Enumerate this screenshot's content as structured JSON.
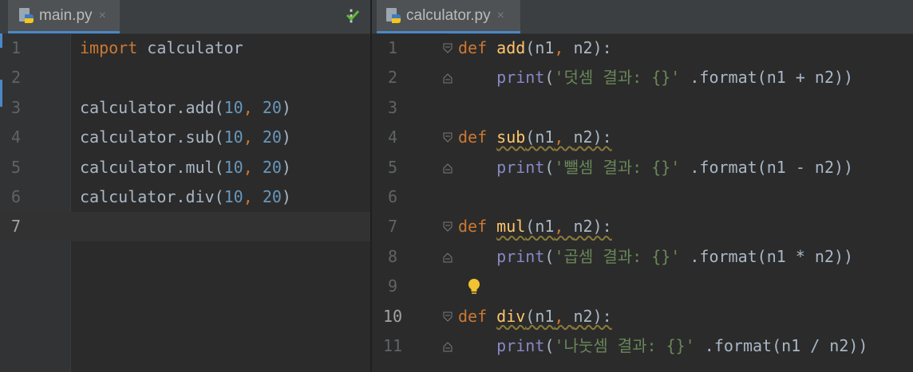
{
  "left_editor": {
    "tab": {
      "file_name": "main.py",
      "close_glyph": "×"
    },
    "menu_icon": "more-vertical-icon",
    "inspection_status": "check-icon",
    "lines": [
      {
        "num": "1",
        "tokens": [
          {
            "t": "import",
            "c": "kw"
          },
          {
            "t": " calculator",
            "c": "pl"
          }
        ]
      },
      {
        "num": "2",
        "tokens": []
      },
      {
        "num": "3",
        "tokens": [
          {
            "t": "calculator.add(",
            "c": "pl"
          },
          {
            "t": "10",
            "c": "num"
          },
          {
            "t": ", ",
            "c": "kw"
          },
          {
            "t": "20",
            "c": "num"
          },
          {
            "t": ")",
            "c": "pl"
          }
        ]
      },
      {
        "num": "4",
        "tokens": [
          {
            "t": "calculator.sub(",
            "c": "pl"
          },
          {
            "t": "10",
            "c": "num"
          },
          {
            "t": ", ",
            "c": "kw"
          },
          {
            "t": "20",
            "c": "num"
          },
          {
            "t": ")",
            "c": "pl"
          }
        ]
      },
      {
        "num": "5",
        "tokens": [
          {
            "t": "calculator.mul(",
            "c": "pl"
          },
          {
            "t": "10",
            "c": "num"
          },
          {
            "t": ", ",
            "c": "kw"
          },
          {
            "t": "20",
            "c": "num"
          },
          {
            "t": ")",
            "c": "pl"
          }
        ]
      },
      {
        "num": "6",
        "tokens": [
          {
            "t": "calculator.div(",
            "c": "pl"
          },
          {
            "t": "10",
            "c": "num"
          },
          {
            "t": ", ",
            "c": "kw"
          },
          {
            "t": "20",
            "c": "num"
          },
          {
            "t": ")",
            "c": "pl"
          }
        ]
      },
      {
        "num": "7",
        "tokens": [],
        "current": true
      }
    ]
  },
  "right_editor": {
    "tab": {
      "file_name": "calculator.py",
      "close_glyph": "×"
    },
    "lines": [
      {
        "num": "1",
        "fold": "open",
        "tokens": [
          {
            "t": "def ",
            "c": "kw"
          },
          {
            "t": "add",
            "c": "fn"
          },
          {
            "t": "(n1",
            "c": "pl"
          },
          {
            "t": ", ",
            "c": "kw"
          },
          {
            "t": "n2):",
            "c": "pl"
          }
        ]
      },
      {
        "num": "2",
        "fold": "close",
        "tokens": [
          {
            "t": "    "
          },
          {
            "t": "print",
            "c": "bi"
          },
          {
            "t": "(",
            "c": "pl"
          },
          {
            "t": "'덧셈 결과: {}'",
            "c": "str"
          },
          {
            "t": " .format(n1 + n2))",
            "c": "pl"
          }
        ]
      },
      {
        "num": "3",
        "tokens": []
      },
      {
        "num": "4",
        "fold": "open",
        "warn": true,
        "tokens": [
          {
            "t": "def ",
            "c": "kw"
          },
          {
            "t": "sub",
            "c": "fn"
          },
          {
            "t": "(n1",
            "c": "pl"
          },
          {
            "t": ", ",
            "c": "kw"
          },
          {
            "t": "n2):",
            "c": "pl"
          }
        ]
      },
      {
        "num": "5",
        "fold": "close",
        "tokens": [
          {
            "t": "    "
          },
          {
            "t": "print",
            "c": "bi"
          },
          {
            "t": "(",
            "c": "pl"
          },
          {
            "t": "'뺄셈 결과: {}'",
            "c": "str"
          },
          {
            "t": " .format(n1 - n2))",
            "c": "pl"
          }
        ]
      },
      {
        "num": "6",
        "tokens": []
      },
      {
        "num": "7",
        "fold": "open",
        "warn": true,
        "tokens": [
          {
            "t": "def ",
            "c": "kw"
          },
          {
            "t": "mul",
            "c": "fn"
          },
          {
            "t": "(n1",
            "c": "pl"
          },
          {
            "t": ", ",
            "c": "kw"
          },
          {
            "t": "n2):",
            "c": "pl"
          }
        ]
      },
      {
        "num": "8",
        "fold": "close",
        "tokens": [
          {
            "t": "    "
          },
          {
            "t": "print",
            "c": "bi"
          },
          {
            "t": "(",
            "c": "pl"
          },
          {
            "t": "'곱셈 결과: {}'",
            "c": "str"
          },
          {
            "t": " .format(n1 * n2))",
            "c": "pl"
          }
        ]
      },
      {
        "num": "9",
        "bulb": true,
        "tokens": []
      },
      {
        "num": "10",
        "fold": "open",
        "warn": true,
        "current": true,
        "tokens": [
          {
            "t": "def ",
            "c": "kw"
          },
          {
            "t": "div",
            "c": "fn"
          },
          {
            "t": "(n1",
            "c": "pl"
          },
          {
            "t": ", ",
            "c": "kw"
          },
          {
            "t": "n2):",
            "c": "pl"
          }
        ]
      },
      {
        "num": "11",
        "fold": "close",
        "tokens": [
          {
            "t": "    "
          },
          {
            "t": "print",
            "c": "bi"
          },
          {
            "t": "(",
            "c": "pl"
          },
          {
            "t": "'나눗셈 결과: {}'",
            "c": "str"
          },
          {
            "t": " .format(n1 / n2))",
            "c": "pl"
          }
        ]
      }
    ]
  }
}
